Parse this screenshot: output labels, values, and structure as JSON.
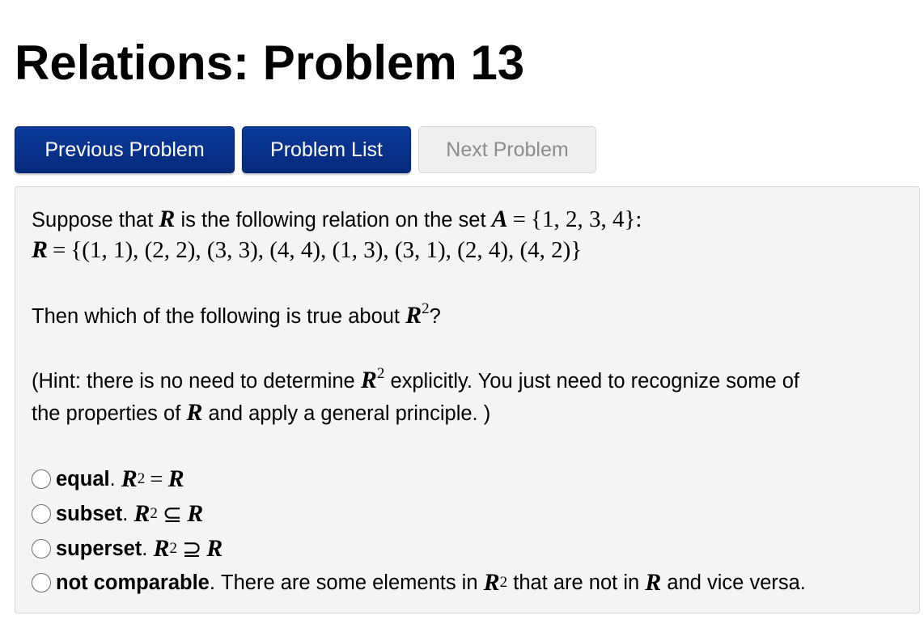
{
  "page": {
    "title": "Relations: Problem 13"
  },
  "nav": {
    "previous_label": "Previous Problem",
    "list_label": "Problem List",
    "next_label": "Next Problem"
  },
  "problem": {
    "intro_pre": "Suppose that",
    "intro_mid": "is the following relation on the set",
    "set_A_lhs": "A",
    "set_A_rhs": "{1, 2, 3, 4}:",
    "relation_lhs": "R",
    "relation_rhs": "{(1, 1), (2, 2), (3, 3), (4, 4), (1, 3), (3, 1), (2, 4), (4, 2)}",
    "relation_symbol": "R",
    "question_pre": "Then which of the following is true about",
    "question_post": "?",
    "hint_pre": "(Hint: there is no need to determine",
    "hint_mid": "explicitly. You just need to recognize some of",
    "hint_line2_pre": "the properties of",
    "hint_line2_post": "and apply a general principle. )",
    "power_base": "R",
    "power_exp": "2",
    "equals": "="
  },
  "choices": [
    {
      "label": "equal",
      "symbol": "=",
      "tail": ""
    },
    {
      "label": "subset",
      "symbol": "⊆",
      "tail": ""
    },
    {
      "label": "superset",
      "symbol": "⊇",
      "tail": ""
    },
    {
      "label": "not comparable",
      "symbol": "",
      "tail_pre": "There are some elements in",
      "tail_mid": "that are not in",
      "tail_post": "and vice versa."
    }
  ],
  "colors": {
    "primary_button": "#062a7c",
    "disabled_button_bg": "#efefef",
    "disabled_button_text": "#8c8c8c",
    "panel_bg": "#f4f4f4"
  }
}
